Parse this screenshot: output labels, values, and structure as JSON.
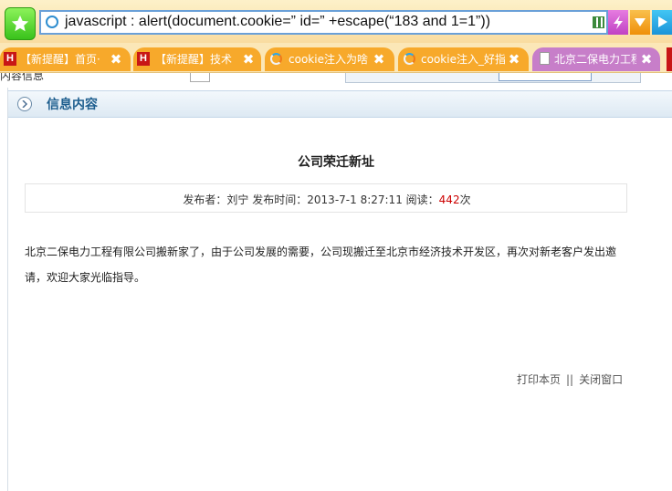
{
  "browser": {
    "address_bar_text": "javascript : alert(document.cookie=” id=”  +escape(“183 and 1=1”))",
    "tabs": [
      {
        "label": "【新提醒】首页·",
        "icon": "H"
      },
      {
        "label": "【新提醒】技术",
        "icon": "H"
      },
      {
        "label": "cookie注入为啥"
      },
      {
        "label": "cookie注入_好指"
      },
      {
        "label": "北京二保电力工程"
      }
    ],
    "tab_close_glyph": "✖"
  },
  "page": {
    "clipped_strip_text": "内容信息",
    "panel_title": "信息内容",
    "article": {
      "title": "公司荣迁新址",
      "publisher_label": "发布者：",
      "publisher": "刘宁",
      "time_label": "发布时间：",
      "time": "2013-7-1 8:27:11",
      "reads_label": "阅读：",
      "reads": "442",
      "reads_unit": "次",
      "body": "北京二保电力工程有限公司搬新家了，由于公司发展的需要，公司现搬迁至北京市经济技术开发区，再次对新老客户发出邀请，欢迎大家光临指导。"
    },
    "footer": {
      "print_label": "打印本页",
      "separator": "||",
      "close_label": "关闭窗口"
    }
  },
  "colors": {
    "tab_orange": "#f7a92b",
    "tab_purple": "#c77ec9",
    "panel_title": "#1f5f8f",
    "read_count": "#cc0000"
  }
}
